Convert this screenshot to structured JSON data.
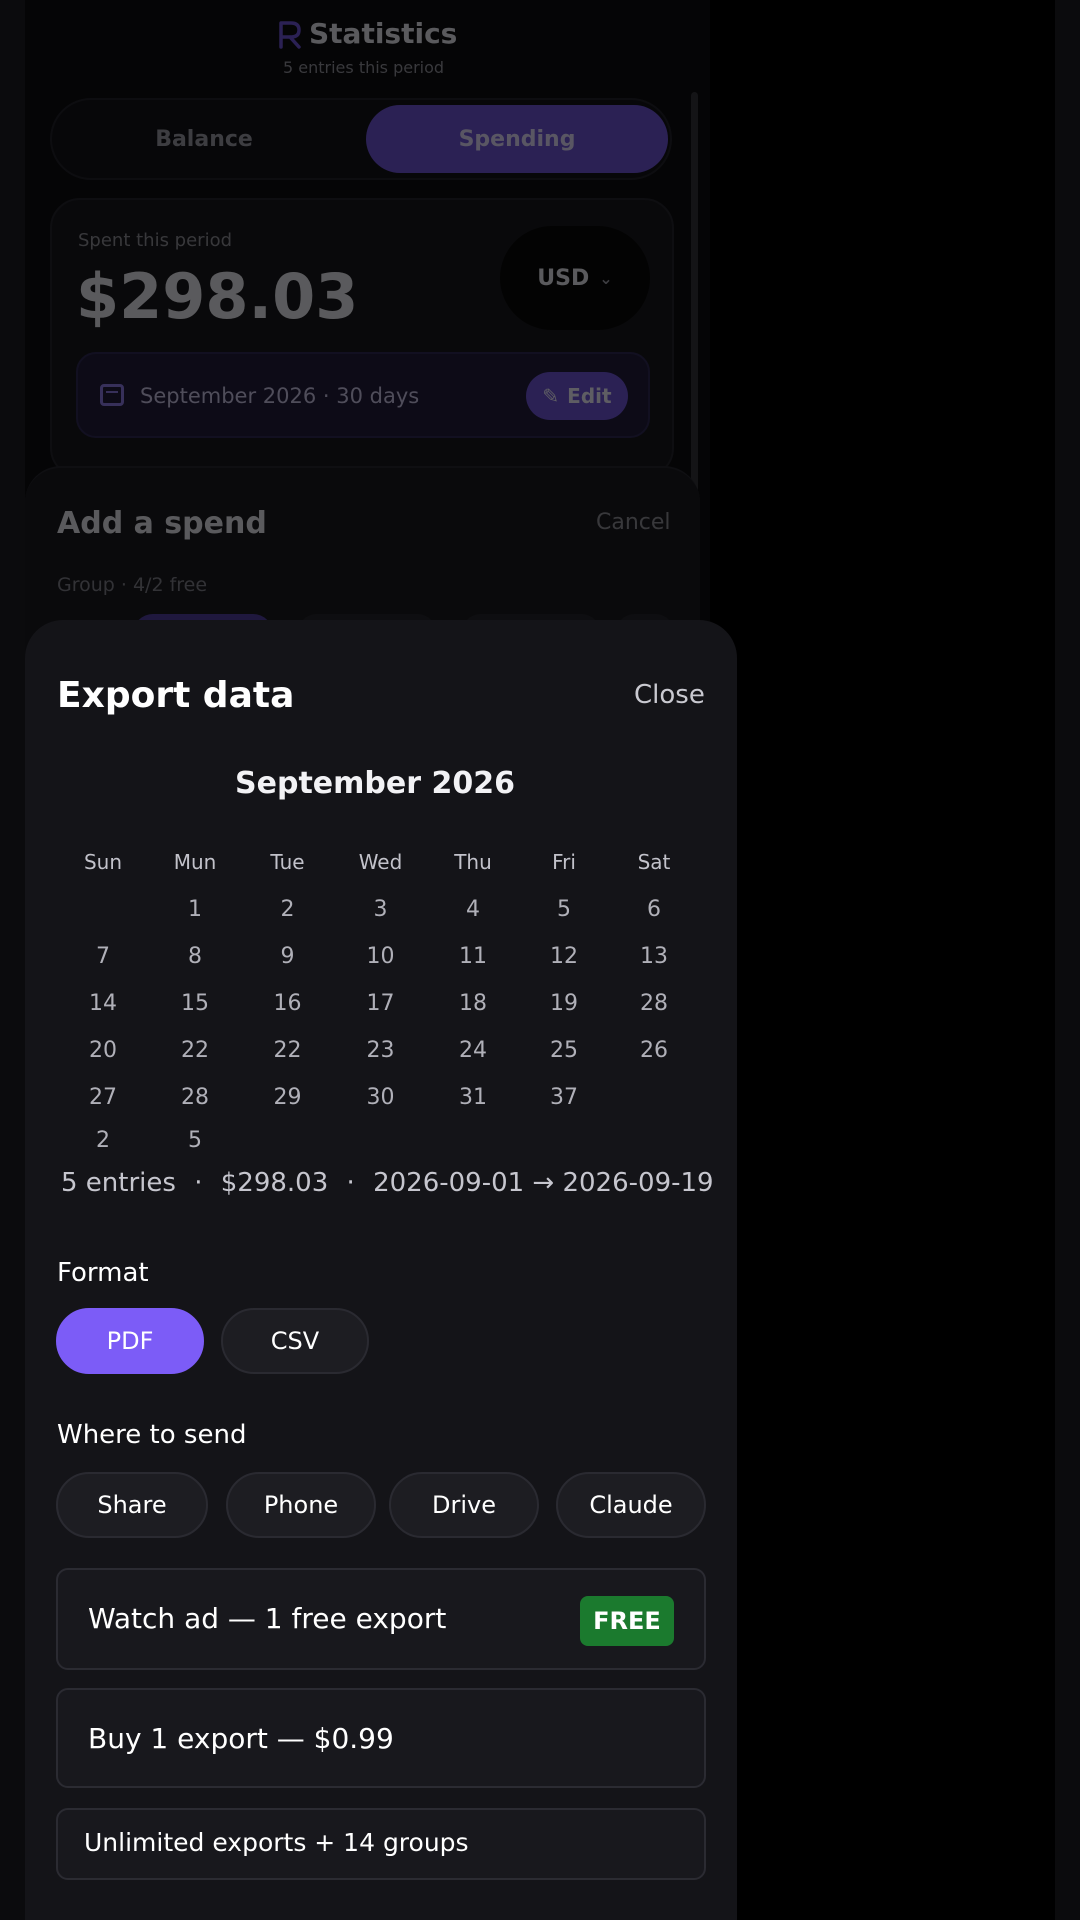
{
  "app": {
    "title": "Statistics",
    "subtitle": "5 entries this period"
  },
  "tabs": [
    {
      "label": "Balance",
      "active": false
    },
    {
      "label": "Spending",
      "active": true
    }
  ],
  "summary_card": {
    "label": "Spent this period",
    "amount": "$298.03",
    "currency": "USD",
    "currency_icon": "chevron-down-icon",
    "period": "September 2026 · 30 days",
    "period_icon": "calendar-icon",
    "edit_label": "Edit",
    "edit_icon": "pencil-icon"
  },
  "add_spend": {
    "title": "Add a spend",
    "cancel_label": "Cancel",
    "group_label": "Group · 4/2 free"
  },
  "export": {
    "title": "Export data",
    "close_label": "Close",
    "month": "September 2026",
    "weekdays": [
      "Sun",
      "Mun",
      "Tue",
      "Wed",
      "Thu",
      "Fri",
      "Sat"
    ],
    "weeks": [
      [
        "",
        "1",
        "2",
        "3",
        "4",
        "5",
        "6"
      ],
      [
        "7",
        "8",
        "9",
        "10",
        "11",
        "12",
        "13"
      ],
      [
        "14",
        "15",
        "16",
        "17",
        "18",
        "19",
        "28"
      ],
      [
        "20",
        "22",
        "22",
        "23",
        "24",
        "25",
        "26"
      ],
      [
        "27",
        "28",
        "29",
        "30",
        "31",
        "37",
        ""
      ],
      [
        "2",
        "5",
        "",
        "",
        "",
        "",
        ""
      ]
    ],
    "summary": {
      "entries": "5 entries",
      "amount": "$298.03",
      "range": "2026-09-01 → 2026-09-19",
      "separator": "·"
    },
    "format_label": "Format",
    "formats": [
      {
        "label": "PDF",
        "active": true
      },
      {
        "label": "CSV",
        "active": false
      }
    ],
    "send_label": "Where to send",
    "destinations": [
      "Share",
      "Phone",
      "Drive",
      "Claude"
    ],
    "options": {
      "watch_ad": "Watch ad — 1 free export",
      "free_badge": "FREE",
      "buy_one": "Buy 1 export — $0.99",
      "unlimited": "Unlimited exports + 14 groups"
    }
  }
}
